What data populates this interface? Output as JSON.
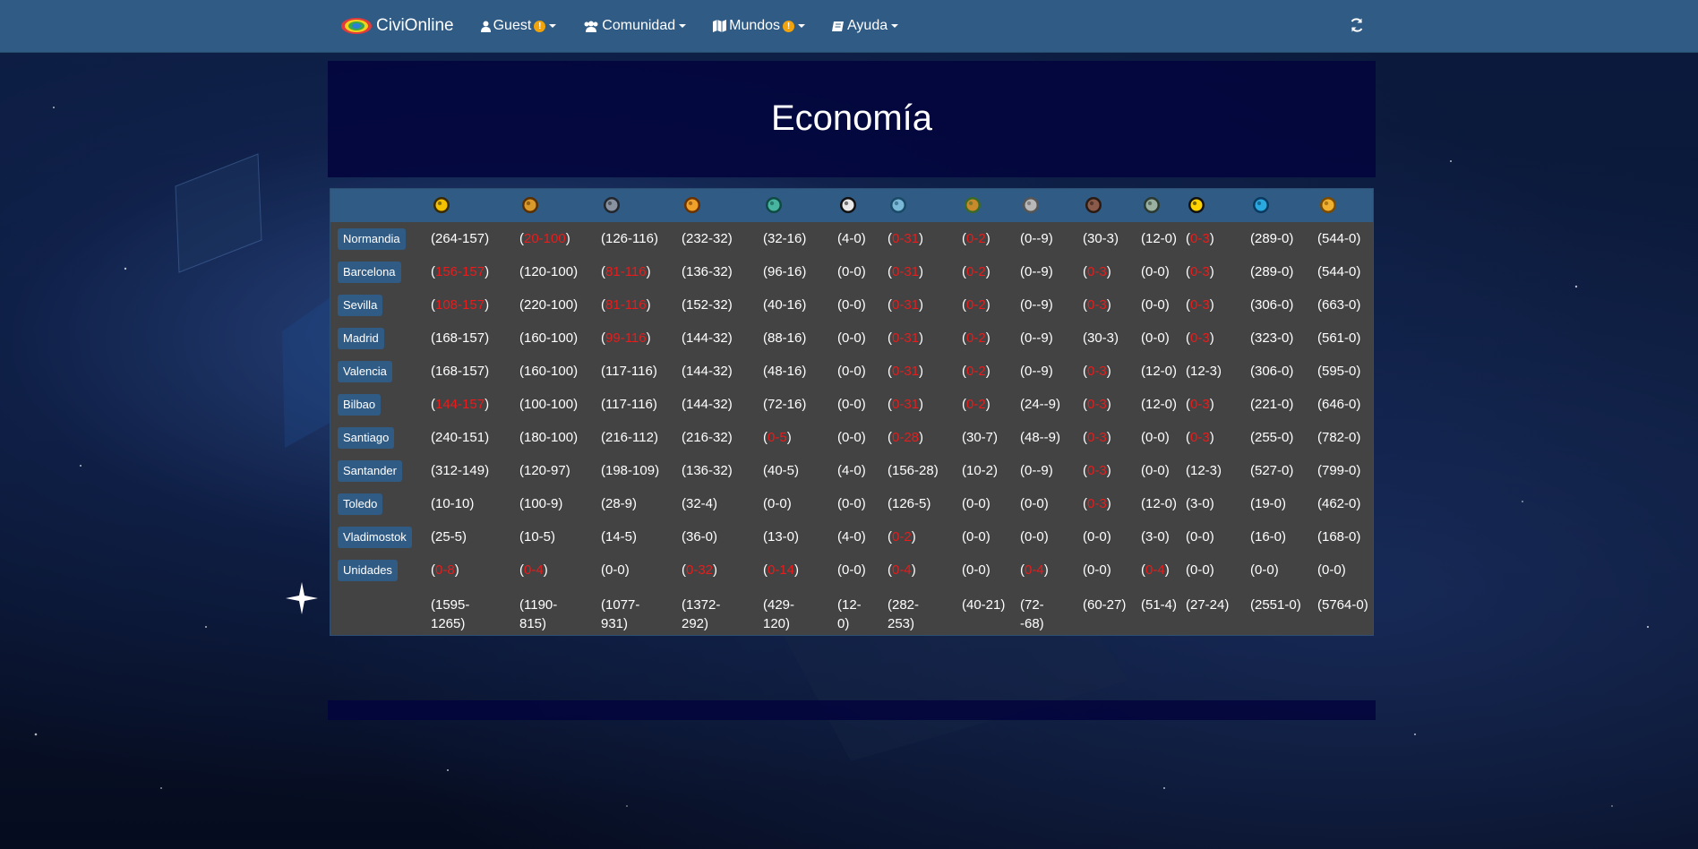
{
  "navbar": {
    "brand": "CiviOnline",
    "items": [
      {
        "label": "Guest",
        "icon": "user-icon",
        "warning": "!"
      },
      {
        "label": "Comunidad",
        "icon": "users-icon",
        "warning": ""
      },
      {
        "label": "Mundos",
        "icon": "map-icon",
        "warning": "!"
      },
      {
        "label": "Ayuda",
        "icon": "book-icon",
        "warning": ""
      }
    ],
    "refresh_icon": "refresh-icon"
  },
  "page": {
    "title": "Economía"
  },
  "colors": {
    "navbar": "#2f5b85",
    "table_bg": "#434343",
    "negative": "#e81c1c",
    "title_bg": "#02043c"
  },
  "resources": [
    {
      "icon": "gold-icon"
    },
    {
      "icon": "food-icon"
    },
    {
      "icon": "stone-icon"
    },
    {
      "icon": "wood-icon"
    },
    {
      "icon": "water-icon"
    },
    {
      "icon": "football-icon"
    },
    {
      "icon": "fish-icon"
    },
    {
      "icon": "mountain-icon"
    },
    {
      "icon": "globe-icon"
    },
    {
      "icon": "ore-icon"
    },
    {
      "icon": "building-icon"
    },
    {
      "icon": "radioactive-icon"
    },
    {
      "icon": "drop-icon"
    },
    {
      "icon": "science-icon"
    }
  ],
  "rows": [
    {
      "city": "Normandia",
      "cells": [
        {
          "a": "264",
          "b": "157",
          "neg": false
        },
        {
          "a": "20",
          "b": "100",
          "neg": true
        },
        {
          "a": "126",
          "b": "116",
          "neg": false
        },
        {
          "a": "232",
          "b": "32",
          "neg": false
        },
        {
          "a": "32",
          "b": "16",
          "neg": false
        },
        {
          "a": "4",
          "b": "0",
          "neg": false
        },
        {
          "a": "0",
          "b": "31",
          "neg": true
        },
        {
          "a": "0",
          "b": "2",
          "neg": true
        },
        {
          "a": "0",
          "b": "-9",
          "neg": false
        },
        {
          "a": "30",
          "b": "3",
          "neg": false
        },
        {
          "a": "12",
          "b": "0",
          "neg": false
        },
        {
          "a": "0",
          "b": "3",
          "neg": true
        },
        {
          "a": "289",
          "b": "0",
          "neg": false
        },
        {
          "a": "544",
          "b": "0",
          "neg": false
        }
      ]
    },
    {
      "city": "Barcelona",
      "cells": [
        {
          "a": "156",
          "b": "157",
          "neg": true
        },
        {
          "a": "120",
          "b": "100",
          "neg": false
        },
        {
          "a": "81",
          "b": "116",
          "neg": true
        },
        {
          "a": "136",
          "b": "32",
          "neg": false
        },
        {
          "a": "96",
          "b": "16",
          "neg": false
        },
        {
          "a": "0",
          "b": "0",
          "neg": false
        },
        {
          "a": "0",
          "b": "31",
          "neg": true
        },
        {
          "a": "0",
          "b": "2",
          "neg": true
        },
        {
          "a": "0",
          "b": "-9",
          "neg": false
        },
        {
          "a": "0",
          "b": "3",
          "neg": true
        },
        {
          "a": "0",
          "b": "0",
          "neg": false
        },
        {
          "a": "0",
          "b": "3",
          "neg": true
        },
        {
          "a": "289",
          "b": "0",
          "neg": false
        },
        {
          "a": "544",
          "b": "0",
          "neg": false
        }
      ]
    },
    {
      "city": "Sevilla",
      "cells": [
        {
          "a": "108",
          "b": "157",
          "neg": true
        },
        {
          "a": "220",
          "b": "100",
          "neg": false
        },
        {
          "a": "81",
          "b": "116",
          "neg": true
        },
        {
          "a": "152",
          "b": "32",
          "neg": false
        },
        {
          "a": "40",
          "b": "16",
          "neg": false
        },
        {
          "a": "0",
          "b": "0",
          "neg": false
        },
        {
          "a": "0",
          "b": "31",
          "neg": true
        },
        {
          "a": "0",
          "b": "2",
          "neg": true
        },
        {
          "a": "0",
          "b": "-9",
          "neg": false
        },
        {
          "a": "0",
          "b": "3",
          "neg": true
        },
        {
          "a": "0",
          "b": "0",
          "neg": false
        },
        {
          "a": "0",
          "b": "3",
          "neg": true
        },
        {
          "a": "306",
          "b": "0",
          "neg": false
        },
        {
          "a": "663",
          "b": "0",
          "neg": false
        }
      ]
    },
    {
      "city": "Madrid",
      "cells": [
        {
          "a": "168",
          "b": "157",
          "neg": false
        },
        {
          "a": "160",
          "b": "100",
          "neg": false
        },
        {
          "a": "99",
          "b": "116",
          "neg": true
        },
        {
          "a": "144",
          "b": "32",
          "neg": false
        },
        {
          "a": "88",
          "b": "16",
          "neg": false
        },
        {
          "a": "0",
          "b": "0",
          "neg": false
        },
        {
          "a": "0",
          "b": "31",
          "neg": true
        },
        {
          "a": "0",
          "b": "2",
          "neg": true
        },
        {
          "a": "0",
          "b": "-9",
          "neg": false
        },
        {
          "a": "30",
          "b": "3",
          "neg": false
        },
        {
          "a": "0",
          "b": "0",
          "neg": false
        },
        {
          "a": "0",
          "b": "3",
          "neg": true
        },
        {
          "a": "323",
          "b": "0",
          "neg": false
        },
        {
          "a": "561",
          "b": "0",
          "neg": false
        }
      ]
    },
    {
      "city": "Valencia",
      "cells": [
        {
          "a": "168",
          "b": "157",
          "neg": false
        },
        {
          "a": "160",
          "b": "100",
          "neg": false
        },
        {
          "a": "117",
          "b": "116",
          "neg": false
        },
        {
          "a": "144",
          "b": "32",
          "neg": false
        },
        {
          "a": "48",
          "b": "16",
          "neg": false
        },
        {
          "a": "0",
          "b": "0",
          "neg": false
        },
        {
          "a": "0",
          "b": "31",
          "neg": true
        },
        {
          "a": "0",
          "b": "2",
          "neg": true
        },
        {
          "a": "0",
          "b": "-9",
          "neg": false
        },
        {
          "a": "0",
          "b": "3",
          "neg": true
        },
        {
          "a": "12",
          "b": "0",
          "neg": false
        },
        {
          "a": "12",
          "b": "3",
          "neg": false
        },
        {
          "a": "306",
          "b": "0",
          "neg": false
        },
        {
          "a": "595",
          "b": "0",
          "neg": false
        }
      ]
    },
    {
      "city": "Bilbao",
      "cells": [
        {
          "a": "144",
          "b": "157",
          "neg": true
        },
        {
          "a": "100",
          "b": "100",
          "neg": false
        },
        {
          "a": "117",
          "b": "116",
          "neg": false
        },
        {
          "a": "144",
          "b": "32",
          "neg": false
        },
        {
          "a": "72",
          "b": "16",
          "neg": false
        },
        {
          "a": "0",
          "b": "0",
          "neg": false
        },
        {
          "a": "0",
          "b": "31",
          "neg": true
        },
        {
          "a": "0",
          "b": "2",
          "neg": true
        },
        {
          "a": "24",
          "b": "-9",
          "neg": false
        },
        {
          "a": "0",
          "b": "3",
          "neg": true
        },
        {
          "a": "12",
          "b": "0",
          "neg": false
        },
        {
          "a": "0",
          "b": "3",
          "neg": true
        },
        {
          "a": "221",
          "b": "0",
          "neg": false
        },
        {
          "a": "646",
          "b": "0",
          "neg": false
        }
      ]
    },
    {
      "city": "Santiago",
      "cells": [
        {
          "a": "240",
          "b": "151",
          "neg": false
        },
        {
          "a": "180",
          "b": "100",
          "neg": false
        },
        {
          "a": "216",
          "b": "112",
          "neg": false
        },
        {
          "a": "216",
          "b": "32",
          "neg": false
        },
        {
          "a": "0",
          "b": "5",
          "neg": true
        },
        {
          "a": "0",
          "b": "0",
          "neg": false
        },
        {
          "a": "0",
          "b": "28",
          "neg": true
        },
        {
          "a": "30",
          "b": "7",
          "neg": false
        },
        {
          "a": "48",
          "b": "-9",
          "neg": false
        },
        {
          "a": "0",
          "b": "3",
          "neg": true
        },
        {
          "a": "0",
          "b": "0",
          "neg": false
        },
        {
          "a": "0",
          "b": "3",
          "neg": true
        },
        {
          "a": "255",
          "b": "0",
          "neg": false
        },
        {
          "a": "782",
          "b": "0",
          "neg": false
        }
      ]
    },
    {
      "city": "Santander",
      "cells": [
        {
          "a": "312",
          "b": "149",
          "neg": false
        },
        {
          "a": "120",
          "b": "97",
          "neg": false
        },
        {
          "a": "198",
          "b": "109",
          "neg": false
        },
        {
          "a": "136",
          "b": "32",
          "neg": false
        },
        {
          "a": "40",
          "b": "5",
          "neg": false
        },
        {
          "a": "4",
          "b": "0",
          "neg": false
        },
        {
          "a": "156",
          "b": "28",
          "neg": false
        },
        {
          "a": "10",
          "b": "2",
          "neg": false
        },
        {
          "a": "0",
          "b": "-9",
          "neg": false
        },
        {
          "a": "0",
          "b": "3",
          "neg": true
        },
        {
          "a": "0",
          "b": "0",
          "neg": false
        },
        {
          "a": "12",
          "b": "3",
          "neg": false
        },
        {
          "a": "527",
          "b": "0",
          "neg": false
        },
        {
          "a": "799",
          "b": "0",
          "neg": false
        }
      ]
    },
    {
      "city": "Toledo",
      "cells": [
        {
          "a": "10",
          "b": "10",
          "neg": false
        },
        {
          "a": "100",
          "b": "9",
          "neg": false
        },
        {
          "a": "28",
          "b": "9",
          "neg": false
        },
        {
          "a": "32",
          "b": "4",
          "neg": false
        },
        {
          "a": "0",
          "b": "0",
          "neg": false
        },
        {
          "a": "0",
          "b": "0",
          "neg": false
        },
        {
          "a": "126",
          "b": "5",
          "neg": false
        },
        {
          "a": "0",
          "b": "0",
          "neg": false
        },
        {
          "a": "0",
          "b": "0",
          "neg": false
        },
        {
          "a": "0",
          "b": "3",
          "neg": true
        },
        {
          "a": "12",
          "b": "0",
          "neg": false
        },
        {
          "a": "3",
          "b": "0",
          "neg": false
        },
        {
          "a": "19",
          "b": "0",
          "neg": false
        },
        {
          "a": "462",
          "b": "0",
          "neg": false
        }
      ]
    },
    {
      "city": "Vladimostok",
      "cells": [
        {
          "a": "25",
          "b": "5",
          "neg": false
        },
        {
          "a": "10",
          "b": "5",
          "neg": false
        },
        {
          "a": "14",
          "b": "5",
          "neg": false
        },
        {
          "a": "36",
          "b": "0",
          "neg": false
        },
        {
          "a": "13",
          "b": "0",
          "neg": false
        },
        {
          "a": "4",
          "b": "0",
          "neg": false
        },
        {
          "a": "0",
          "b": "2",
          "neg": true
        },
        {
          "a": "0",
          "b": "0",
          "neg": false
        },
        {
          "a": "0",
          "b": "0",
          "neg": false
        },
        {
          "a": "0",
          "b": "0",
          "neg": false
        },
        {
          "a": "3",
          "b": "0",
          "neg": false
        },
        {
          "a": "0",
          "b": "0",
          "neg": false
        },
        {
          "a": "16",
          "b": "0",
          "neg": false
        },
        {
          "a": "168",
          "b": "0",
          "neg": false
        }
      ]
    },
    {
      "city": "Unidades",
      "cells": [
        {
          "a": "0",
          "b": "8",
          "neg": true
        },
        {
          "a": "0",
          "b": "4",
          "neg": true
        },
        {
          "a": "0",
          "b": "0",
          "neg": false
        },
        {
          "a": "0",
          "b": "32",
          "neg": true
        },
        {
          "a": "0",
          "b": "14",
          "neg": true
        },
        {
          "a": "0",
          "b": "0",
          "neg": false
        },
        {
          "a": "0",
          "b": "4",
          "neg": true
        },
        {
          "a": "0",
          "b": "0",
          "neg": false
        },
        {
          "a": "0",
          "b": "4",
          "neg": true
        },
        {
          "a": "0",
          "b": "0",
          "neg": false
        },
        {
          "a": "0",
          "b": "4",
          "neg": true
        },
        {
          "a": "0",
          "b": "0",
          "neg": false
        },
        {
          "a": "0",
          "b": "0",
          "neg": false
        },
        {
          "a": "0",
          "b": "0",
          "neg": false
        }
      ]
    }
  ],
  "totals": [
    {
      "l1": "(1595-",
      "l2": "1265)"
    },
    {
      "l1": "(1190-",
      "l2": "815)"
    },
    {
      "l1": "(1077-",
      "l2": "931)"
    },
    {
      "l1": "(1372-",
      "l2": "292)"
    },
    {
      "l1": "(429-",
      "l2": "120)"
    },
    {
      "l1": "(12-",
      "l2": "0)"
    },
    {
      "l1": "(282-",
      "l2": "253)"
    },
    {
      "l1": "(40-21)",
      "l2": ""
    },
    {
      "l1": "(72-",
      "l2": "-68)"
    },
    {
      "l1": "(60-27)",
      "l2": ""
    },
    {
      "l1": "(51-4)",
      "l2": ""
    },
    {
      "l1": "(27-24)",
      "l2": ""
    },
    {
      "l1": "(2551-0)",
      "l2": ""
    },
    {
      "l1": "(5764-0)",
      "l2": ""
    }
  ]
}
